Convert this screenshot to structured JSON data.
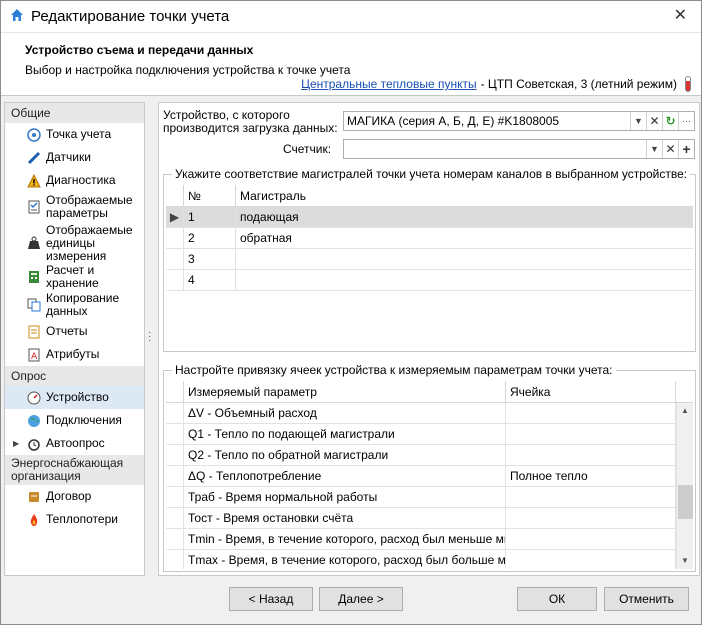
{
  "window": {
    "title": "Редактирование точки учета"
  },
  "header": {
    "title": "Устройство съема и передачи данных",
    "subtitle": "Выбор и настройка подключения устройства к точке учета",
    "location_link": "Центральные тепловые пункты",
    "location_text": "- ЦТП Советская, 3 (летний режим)"
  },
  "sidebar": {
    "groups": [
      {
        "label": "Общие"
      },
      {
        "label": "Опрос"
      },
      {
        "label": "Энергоснабжающая организация"
      }
    ],
    "items": [
      {
        "label": "Точка учета"
      },
      {
        "label": "Датчики"
      },
      {
        "label": "Диагностика"
      },
      {
        "label": "Отображаемые параметры"
      },
      {
        "label": "Отображаемые единицы измерения"
      },
      {
        "label": "Расчет и хранение"
      },
      {
        "label": "Копирование данных"
      },
      {
        "label": "Отчеты"
      },
      {
        "label": "Атрибуты"
      },
      {
        "label": "Устройство"
      },
      {
        "label": "Подключения"
      },
      {
        "label": "Автоопрос"
      },
      {
        "label": "Договор"
      },
      {
        "label": "Теплопотери"
      }
    ]
  },
  "form": {
    "device_label": "Устройство, с которого производится загрузка данных:",
    "device_value": "МАГИКА (серия А, Б, Д, Е) #K1808005",
    "counter_label": "Счетчик:",
    "counter_value": ""
  },
  "channels": {
    "legend": "Укажите соответствие магистралей точки учета номерам каналов в выбранном устройстве:",
    "col_num": "№",
    "col_main": "Магистраль",
    "rows": [
      {
        "num": "1",
        "main": "подающая"
      },
      {
        "num": "2",
        "main": "обратная"
      },
      {
        "num": "3",
        "main": ""
      },
      {
        "num": "4",
        "main": ""
      }
    ]
  },
  "params": {
    "legend": "Настройте привязку ячеек устройства к измеряемым параметрам точки учета:",
    "col_param": "Измеряемый параметр",
    "col_cell": "Ячейка",
    "rows": [
      {
        "param": "ΔV - Объемный расход",
        "cell": ""
      },
      {
        "param": "Q1 - Тепло по подающей магистрали",
        "cell": ""
      },
      {
        "param": "Q2 - Тепло по обратной магистрали",
        "cell": ""
      },
      {
        "param": "ΔQ - Теплопотребление",
        "cell": "Полное тепло"
      },
      {
        "param": "Траб - Время нормальной работы",
        "cell": ""
      },
      {
        "param": "Тост - Время остановки счёта",
        "cell": ""
      },
      {
        "param": "Tmin - Время, в течение которого, расход был меньше мини…",
        "cell": ""
      },
      {
        "param": "Tmax - Время, в течение которого, расход был больше мак…",
        "cell": ""
      }
    ]
  },
  "buttons": {
    "back": "< Назад",
    "next": "Далее >",
    "ok": "ОК",
    "cancel": "Отменить"
  },
  "colors": {
    "link": "#1a4fb3",
    "selection": "#dde8f5"
  }
}
